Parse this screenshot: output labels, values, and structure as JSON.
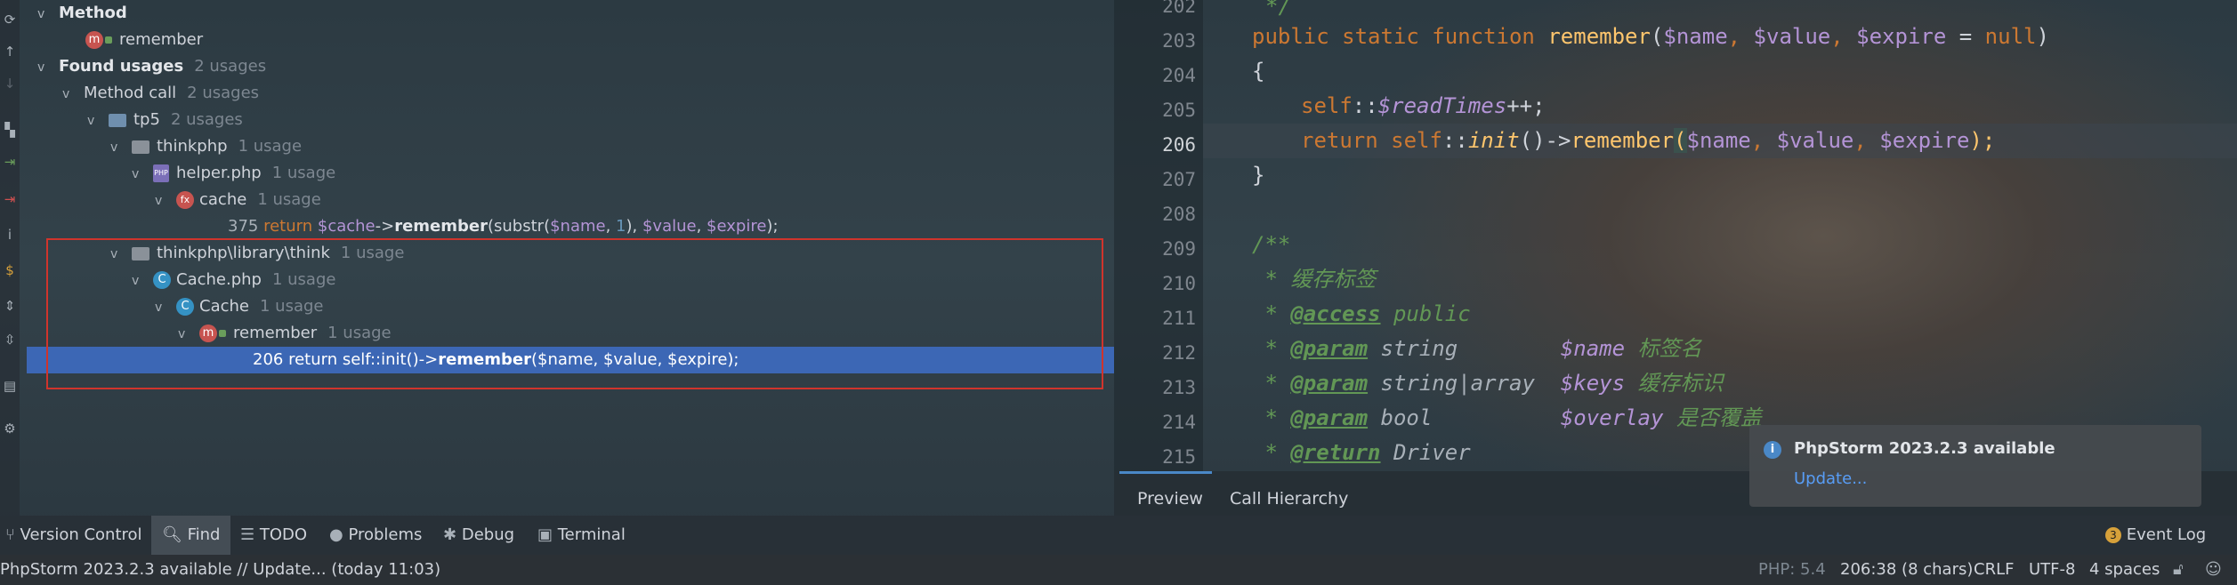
{
  "find": {
    "method_header": "Method",
    "method_name": "remember",
    "found_usages_label": "Found usages",
    "found_usages_count": "2 usages",
    "method_call_label": "Method call",
    "method_call_count": "2 usages",
    "tp5_label": "tp5",
    "tp5_count": "2 usages",
    "thinkphp_label": "thinkphp",
    "thinkphp_count": "1 usage",
    "helper_label": "helper.php",
    "helper_count": "1 usage",
    "cache_fn_label": "cache",
    "cache_fn_count": "1 usage",
    "usage1": {
      "line": "375",
      "kw_return": "return",
      "var_cache": "$cache",
      "arrow": "->",
      "method": "remember",
      "call": "(substr(",
      "var_name": "$name",
      "comma1": ", ",
      "num": "1",
      "close1": "), ",
      "var_value": "$value",
      "comma2": ", ",
      "var_expire": "$expire",
      "end": ");"
    },
    "library_label": "thinkphp\\library\\think",
    "library_count": "1 usage",
    "cachephp_label": "Cache.php",
    "cachephp_count": "1 usage",
    "cache_class_label": "Cache",
    "cache_class_count": "1 usage",
    "remember_label": "remember",
    "remember_count": "1 usage",
    "usage2": {
      "prefix": "206 return self::init()->",
      "method": "remember",
      "suffix": "($name, $value, $expire);"
    }
  },
  "editor": {
    "line_numbers": [
      "202",
      "203",
      "204",
      "205",
      "206",
      "207",
      "208",
      "209",
      "210",
      "211",
      "212",
      "213",
      "214",
      "215"
    ],
    "l202": "*/",
    "l203_a": "public static function ",
    "l203_fn": "remember",
    "l203_b": "(",
    "l203_v1": "$name",
    "l203_c": ", ",
    "l203_v2": "$value",
    "l203_d": ", ",
    "l203_v3": "$expire",
    "l203_e": " = ",
    "l203_null": "null",
    "l203_f": ")",
    "l204": "{",
    "l205_self": "self",
    "l205_dc": "::",
    "l205_v": "$readTimes",
    "l205_end": "++;",
    "l206_ret": "return self",
    "l206_dc": "::",
    "l206_init": "init",
    "l206_arrow": "()->",
    "l206_fn": "remember",
    "l206_paren": "(",
    "l206_v1": "$name",
    "l206_c1": ", ",
    "l206_v2": "$value",
    "l206_c2": ", ",
    "l206_v3": "$expire",
    "l206_end": ");",
    "l207": "}",
    "l209": "/**",
    "l210": " * 缓存标签",
    "l211_star": " * ",
    "l211_tag": "@access",
    "l211_rest": " public",
    "l212_star": " * ",
    "l212_tag": "@param",
    "l212_type": " string        ",
    "l212_var": "$name",
    "l212_desc": " 标签名",
    "l213_star": " * ",
    "l213_tag": "@param",
    "l213_type": " string|array  ",
    "l213_var": "$keys",
    "l213_desc": " 缓存标识",
    "l214_star": " * ",
    "l214_tag": "@param",
    "l214_type": " bool          ",
    "l214_var": "$overlay",
    "l214_desc": " 是否覆盖",
    "l215_star": " * ",
    "l215_tag": "@return",
    "l215_type": " Driver"
  },
  "preview_tabs": [
    "Preview",
    "Call Hierarchy"
  ],
  "tool_windows": {
    "version_control": "Version Control",
    "find": "Find",
    "todo": "TODO",
    "problems": "Problems",
    "debug": "Debug",
    "terminal": "Terminal",
    "event_log": "Event Log",
    "event_log_badge": "3"
  },
  "notification": {
    "title": "PhpStorm 2023.2.3 available",
    "action": "Update..."
  },
  "status": {
    "message": "PhpStorm 2023.2.3 available // Update... (today 11:03)",
    "php": "PHP: 5.4",
    "position": "206:38 (8 chars)",
    "line_sep": "CRLF",
    "encoding": "UTF-8",
    "indent": "4 spaces"
  },
  "colors": {
    "selection": "#3c67b5",
    "highlight_box": "#d0342c",
    "keyword": "#cc7832",
    "function": "#ffc66d",
    "variable": "#b494d6",
    "comment": "#629755"
  },
  "icons": [
    "refresh-icon",
    "arrow-up-icon",
    "arrow-down-icon",
    "group-icon",
    "merge-icon",
    "navigate-icon",
    "info-icon",
    "dollar-icon",
    "expand-icon",
    "collapse-icon",
    "preview-icon",
    "settings-icon",
    "lock-icon",
    "smile-icon"
  ]
}
